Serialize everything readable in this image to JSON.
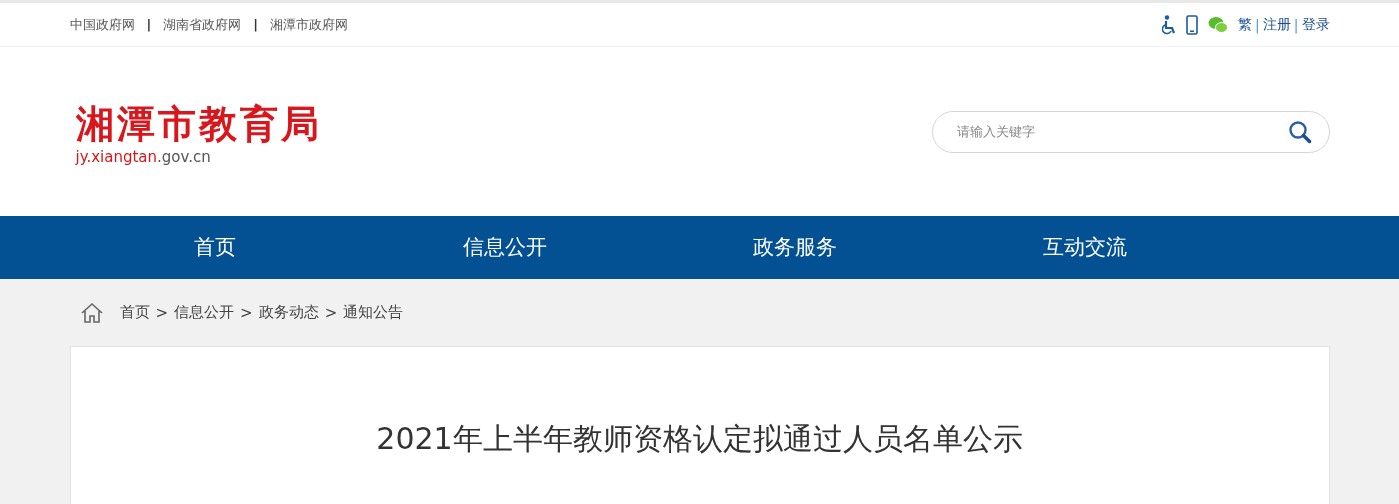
{
  "top_links": [
    "中国政府网",
    "湖南省政府网",
    "湘潭市政府网"
  ],
  "top_separator": "|",
  "user_links": [
    {
      "kind": "link",
      "text": "繁"
    },
    {
      "kind": "sep",
      "text": "|"
    },
    {
      "kind": "link",
      "text": "注册"
    },
    {
      "kind": "sep",
      "text": "|"
    },
    {
      "kind": "link",
      "text": "登录"
    }
  ],
  "logo": {
    "title": "湘潭市教育局",
    "domain_main": "jy.xiangtan",
    "domain_rest": ".gov.cn"
  },
  "search": {
    "placeholder": "请输入关键字"
  },
  "nav": [
    "首页",
    "信息公开",
    "政务服务",
    "互动交流"
  ],
  "breadcrumb": {
    "items": [
      "首页",
      "信息公开",
      "政务动态",
      "通知公告"
    ],
    "separator": ">"
  },
  "article": {
    "title": "2021年上半年教师资格认定拟通过人员名单公示"
  }
}
